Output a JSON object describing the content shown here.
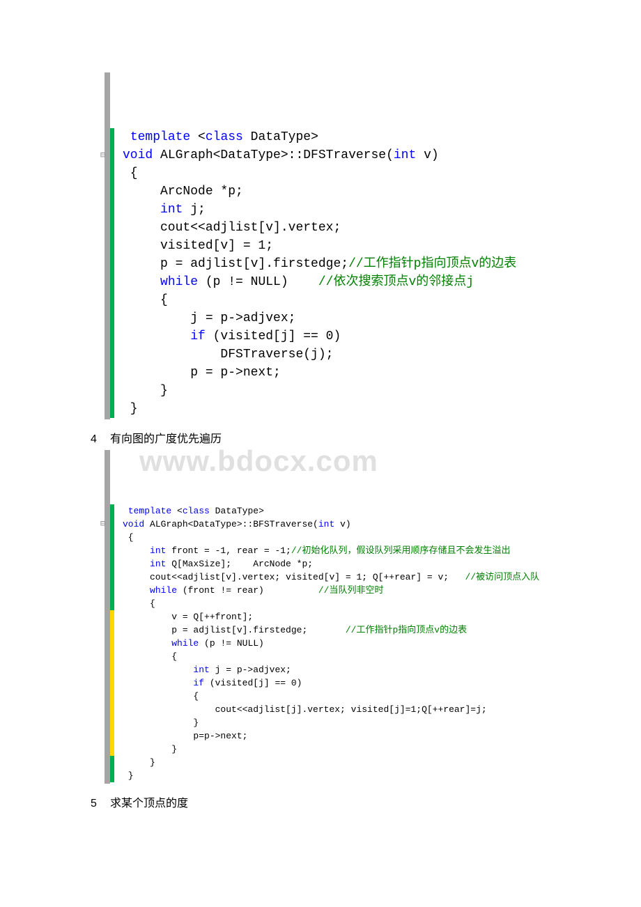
{
  "block1": {
    "lines": [
      {
        "mark": "green",
        "parts": [
          {
            "t": " ",
            "c": "txt"
          },
          {
            "t": "template",
            "c": "kw"
          },
          {
            "t": " <",
            "c": "txt"
          },
          {
            "t": "class",
            "c": "kw"
          },
          {
            "t": " DataType>",
            "c": "txt"
          }
        ]
      },
      {
        "mark": "green",
        "fold": true,
        "parts": [
          {
            "t": "void",
            "c": "kw"
          },
          {
            "t": " ALGraph<DataType>::DFSTraverse(",
            "c": "txt"
          },
          {
            "t": "int",
            "c": "kw"
          },
          {
            "t": " v)",
            "c": "txt"
          }
        ]
      },
      {
        "mark": "green",
        "parts": [
          {
            "t": " {",
            "c": "txt"
          }
        ]
      },
      {
        "mark": "green",
        "parts": [
          {
            "t": "     ArcNode *p;",
            "c": "txt"
          }
        ]
      },
      {
        "mark": "green",
        "parts": [
          {
            "t": "     ",
            "c": "txt"
          },
          {
            "t": "int",
            "c": "kw"
          },
          {
            "t": " j;",
            "c": "txt"
          }
        ]
      },
      {
        "mark": "green",
        "parts": [
          {
            "t": "     cout<<adjlist[v].vertex;",
            "c": "txt"
          }
        ]
      },
      {
        "mark": "green",
        "parts": [
          {
            "t": "     visited[v] = 1;",
            "c": "txt"
          }
        ]
      },
      {
        "mark": "green",
        "parts": [
          {
            "t": "     p = adjlist[v].firstedge;",
            "c": "txt"
          },
          {
            "t": "//工作指针p指向顶点v的边表",
            "c": "comment"
          }
        ]
      },
      {
        "mark": "green",
        "parts": [
          {
            "t": "     ",
            "c": "txt"
          },
          {
            "t": "while",
            "c": "kw"
          },
          {
            "t": " (p != NULL)    ",
            "c": "txt"
          },
          {
            "t": "//依次搜索顶点v的邻接点j",
            "c": "comment"
          }
        ]
      },
      {
        "mark": "green",
        "parts": [
          {
            "t": "     {",
            "c": "txt"
          }
        ]
      },
      {
        "mark": "green",
        "parts": [
          {
            "t": "         j = p->adjvex;",
            "c": "txt"
          }
        ]
      },
      {
        "mark": "green",
        "parts": [
          {
            "t": "         ",
            "c": "txt"
          },
          {
            "t": "if",
            "c": "kw"
          },
          {
            "t": " (visited[j] == 0)",
            "c": "txt"
          }
        ]
      },
      {
        "mark": "green",
        "parts": [
          {
            "t": "             DFSTraverse(j);",
            "c": "txt"
          }
        ]
      },
      {
        "mark": "green",
        "parts": [
          {
            "t": "         p = p->next;",
            "c": "txt"
          }
        ]
      },
      {
        "mark": "green",
        "parts": [
          {
            "t": "     }",
            "c": "txt"
          }
        ]
      },
      {
        "mark": "green",
        "parts": [
          {
            "t": " }",
            "c": "txt"
          }
        ]
      }
    ]
  },
  "heading4": {
    "num": "4",
    "text": "有向图的广度优先遍历"
  },
  "block2": {
    "watermark": "www.bdocx.com",
    "lines": [
      {
        "mark": "green",
        "parts": [
          {
            "t": " ",
            "c": "txt"
          },
          {
            "t": "template",
            "c": "kw"
          },
          {
            "t": " <",
            "c": "txt"
          },
          {
            "t": "class",
            "c": "kw"
          },
          {
            "t": " DataType>",
            "c": "txt"
          }
        ]
      },
      {
        "mark": "green",
        "fold": true,
        "parts": [
          {
            "t": "void",
            "c": "kw"
          },
          {
            "t": " ALGraph<DataType>::BFSTraverse(",
            "c": "txt"
          },
          {
            "t": "int",
            "c": "kw"
          },
          {
            "t": " v)",
            "c": "txt"
          }
        ]
      },
      {
        "mark": "green",
        "parts": [
          {
            "t": " {",
            "c": "txt"
          }
        ]
      },
      {
        "mark": "green",
        "parts": [
          {
            "t": "     ",
            "c": "txt"
          },
          {
            "t": "int",
            "c": "kw"
          },
          {
            "t": " front = -1, rear = -1;",
            "c": "txt"
          },
          {
            "t": "//初始化队列，假设队列采用顺序存储且不会发生溢出",
            "c": "comment"
          }
        ]
      },
      {
        "mark": "green",
        "parts": [
          {
            "t": "     ",
            "c": "txt"
          },
          {
            "t": "int",
            "c": "kw"
          },
          {
            "t": " Q[MaxSize];    ArcNode *p;",
            "c": "txt"
          }
        ]
      },
      {
        "mark": "green",
        "parts": [
          {
            "t": "     cout<<adjlist[v].vertex; visited[v] = 1; Q[++rear] = v;   ",
            "c": "txt"
          },
          {
            "t": "//被访问顶点入队",
            "c": "comment"
          }
        ]
      },
      {
        "mark": "green",
        "parts": [
          {
            "t": "     ",
            "c": "txt"
          },
          {
            "t": "while",
            "c": "kw"
          },
          {
            "t": " (front != rear)          ",
            "c": "txt"
          },
          {
            "t": "//当队列非空时",
            "c": "comment"
          }
        ]
      },
      {
        "mark": "green",
        "parts": [
          {
            "t": "     {",
            "c": "txt"
          }
        ]
      },
      {
        "mark": "yellow",
        "parts": [
          {
            "t": "         v = Q[++front];",
            "c": "txt"
          }
        ]
      },
      {
        "mark": "yellow",
        "parts": [
          {
            "t": "         p = adjlist[v].firstedge;       ",
            "c": "txt"
          },
          {
            "t": "//工作指针p指向顶点v的边表",
            "c": "comment"
          }
        ]
      },
      {
        "mark": "yellow",
        "parts": [
          {
            "t": "         ",
            "c": "txt"
          },
          {
            "t": "while",
            "c": "kw"
          },
          {
            "t": " (p != NULL)",
            "c": "txt"
          }
        ]
      },
      {
        "mark": "yellow",
        "parts": [
          {
            "t": "         {",
            "c": "txt"
          }
        ]
      },
      {
        "mark": "yellow",
        "parts": [
          {
            "t": "             ",
            "c": "txt"
          },
          {
            "t": "int",
            "c": "kw"
          },
          {
            "t": " j = p->adjvex;",
            "c": "txt"
          }
        ]
      },
      {
        "mark": "yellow",
        "parts": [
          {
            "t": "             ",
            "c": "txt"
          },
          {
            "t": "if",
            "c": "kw"
          },
          {
            "t": " (visited[j] == 0)",
            "c": "txt"
          }
        ]
      },
      {
        "mark": "yellow",
        "parts": [
          {
            "t": "             {",
            "c": "txt"
          }
        ]
      },
      {
        "mark": "yellow",
        "parts": [
          {
            "t": "                 cout<<adjlist[j].vertex; visited[j]=1;Q[++rear]=j;",
            "c": "txt"
          }
        ]
      },
      {
        "mark": "yellow",
        "parts": [
          {
            "t": "             }",
            "c": "txt"
          }
        ]
      },
      {
        "mark": "yellow",
        "parts": [
          {
            "t": "             p=p->next;",
            "c": "txt"
          }
        ]
      },
      {
        "mark": "yellow",
        "parts": [
          {
            "t": "         }",
            "c": "txt"
          }
        ]
      },
      {
        "mark": "green",
        "parts": [
          {
            "t": "     }",
            "c": "txt"
          }
        ]
      },
      {
        "mark": "green",
        "parts": [
          {
            "t": " }",
            "c": "txt"
          }
        ]
      }
    ]
  },
  "heading5": {
    "num": "5",
    "text": "求某个顶点的度"
  }
}
